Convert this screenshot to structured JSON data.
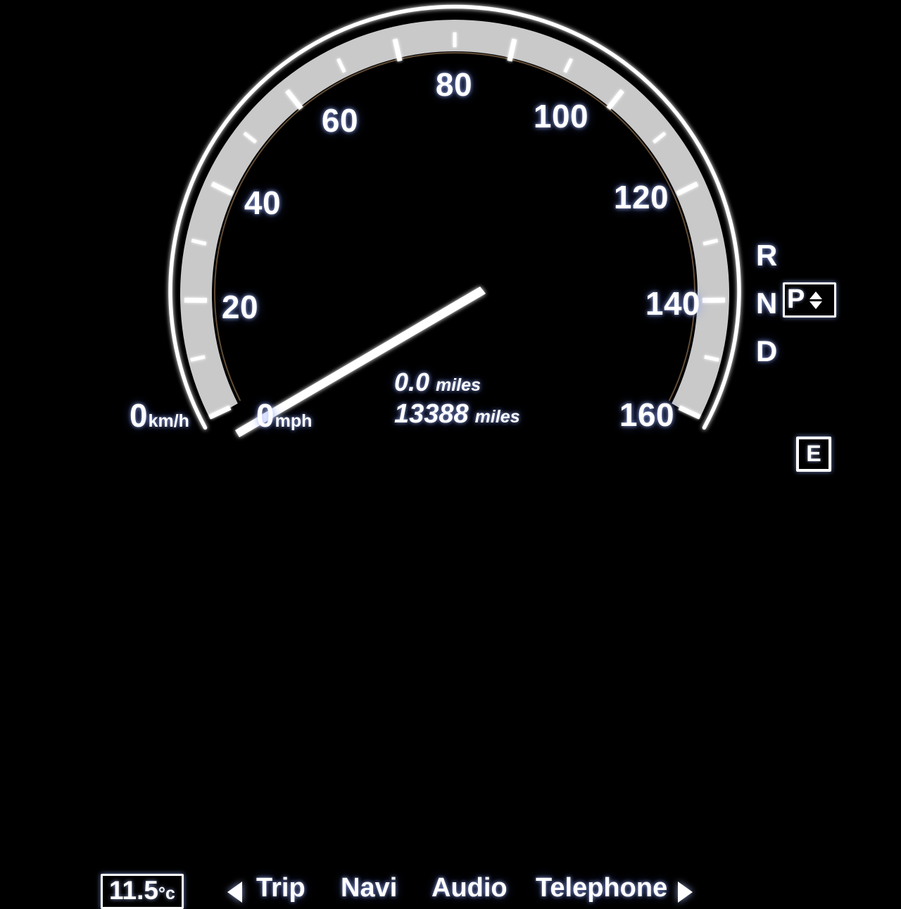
{
  "display": {
    "background_color": "#000000",
    "accent_color": "#ffffff",
    "dial_band_color": "#c8c8c8"
  },
  "gauge": {
    "type": "speedometer",
    "unit_primary": "mph",
    "tick_labels": [
      "20",
      "40",
      "60",
      "80",
      "100",
      "120",
      "140",
      "160"
    ],
    "tick_values": [
      20,
      40,
      60,
      80,
      100,
      120,
      140,
      160
    ],
    "scale_min": 0,
    "scale_max": 180,
    "major_step": 20,
    "minor_step": 10,
    "start_angle_deg": 205,
    "end_angle_deg": -25,
    "needle_value": 0,
    "labels": {
      "l0": "20",
      "l1": "40",
      "l2": "60",
      "l3": "80",
      "l4": "100",
      "l5": "120",
      "l6": "140",
      "l7": "160"
    }
  },
  "speed": {
    "kmh_value": "0",
    "kmh_unit": "km/h",
    "mph_value": "0",
    "mph_unit": "mph"
  },
  "trip": {
    "trip_value": "0.0",
    "trip_unit": "miles",
    "odometer_value": "13388",
    "odometer_unit": "miles"
  },
  "temperature": {
    "value": "11.5",
    "unit": "°c"
  },
  "menu": {
    "prev_arrow": "◀",
    "next_arrow": "▶",
    "items": [
      {
        "label": "Trip"
      },
      {
        "label": "Navi"
      },
      {
        "label": "Audio"
      },
      {
        "label": "Telephone"
      }
    ]
  },
  "gear": {
    "positions": [
      "R",
      "N",
      "D"
    ],
    "r_label": "R",
    "n_label": "N",
    "d_label": "D",
    "selected": "P",
    "shift_up_icon": "triangle-up",
    "shift_down_icon": "triangle-down"
  },
  "fuel": {
    "empty_label": "E"
  }
}
